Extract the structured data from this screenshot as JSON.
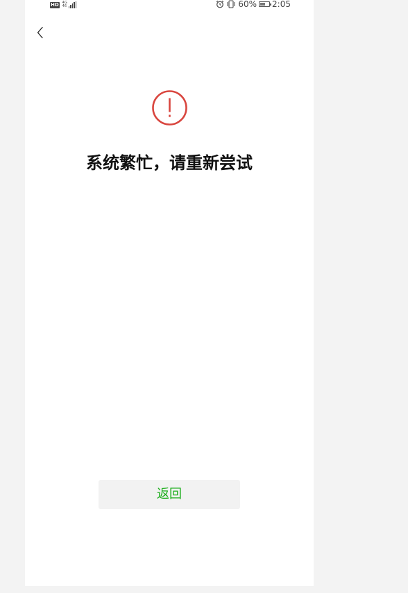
{
  "status_bar": {
    "hd_label": "HD",
    "network_label_top": "4G",
    "network_label_bottom": "46",
    "battery_percent_text": "60%",
    "battery_level": 0.6,
    "time": "2:05",
    "icons": [
      "hd-icon",
      "network-4g-icon",
      "signal-icon",
      "alarm-icon",
      "vibrate-icon",
      "battery-icon"
    ]
  },
  "header": {
    "back_icon": "chevron-left-icon"
  },
  "main": {
    "status_icon": "warning-circle-icon",
    "status_color": "#d9463f",
    "title": "系统繁忙，请重新尝试"
  },
  "footer": {
    "return_label": "返回",
    "return_color": "#1aad19"
  }
}
